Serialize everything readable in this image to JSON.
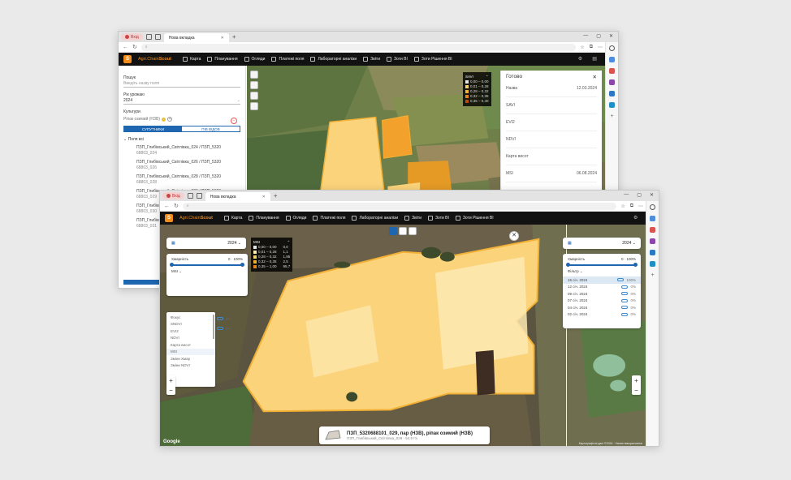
{
  "browser": {
    "profile_label": "Вхід",
    "tab_title": "Нова вкладка",
    "new_tab": "+",
    "window_controls": [
      "—",
      "▢",
      "✕"
    ]
  },
  "app": {
    "brand_prefix": "Agri.Chain",
    "brand_suffix": "Scout",
    "nav": [
      "Карта",
      "Планування",
      "Огляди",
      "Платежі поля",
      "Лабораторні аналізи",
      "Звіти",
      "Зоти ВІ",
      "Зоти Рішення ВІ"
    ]
  },
  "back": {
    "search_label": "Пошук",
    "search_placeholder": "Введіть назву поля",
    "year_label": "Рік урожаю",
    "year_value": "2024",
    "crops_label": "Культури",
    "crop_chip": "Ріпак озимий (НЗВ)",
    "toggle_left": "СУПУТНИКИ",
    "toggle_right": "ПІВ ВІДОВ",
    "tree_head": "Поля всі",
    "tree_items": [
      {
        "name": "ПЗП_Глибівський_Світлівка_024 / ПЗП_5320",
        "sub": "68803_024"
      },
      {
        "name": "ПЗП_Глибівський_Світлівка_026 / ПЗП_5320",
        "sub": "68803_026"
      },
      {
        "name": "ПЗП_Глибівський_Світлівка_028 / ПЗП_5320",
        "sub": "68803_028"
      },
      {
        "name": "ПЗП_Глибівський_Світлівка_029 / ПЗП_5320",
        "sub": "68803_029"
      },
      {
        "name": "ПЗП_Глибівський_Світлівка_030 / ПЗП_5320",
        "sub": "68803_030"
      },
      {
        "name": "ПЗП_Глибівський_Світлівка_031 / ПЗП_5320",
        "sub": "68803_031"
      }
    ],
    "legend": {
      "index": "SAVI",
      "rows": [
        {
          "color": "#e6e6e6",
          "range": "0,00 – 0,00"
        },
        {
          "color": "#f6d36b",
          "range": "0,01 – 0,28"
        },
        {
          "color": "#f2b035",
          "range": "0,28 – 0,32"
        },
        {
          "color": "#e5841c",
          "range": "0,32 – 0,35"
        },
        {
          "color": "#b54c10",
          "range": "0,35 – 0,40"
        }
      ]
    },
    "panel": {
      "title": "Готово",
      "rows": [
        {
          "label": "Назва",
          "value": "12.03.2024"
        },
        {
          "label": "SAVI",
          "value": ""
        },
        {
          "label": "EVI2",
          "value": ""
        },
        {
          "label": "NDVI",
          "value": ""
        },
        {
          "label": "Карта висот",
          "value": ""
        },
        {
          "label": "MSI",
          "value": "06.08.2024"
        }
      ]
    }
  },
  "front": {
    "left_date_year": "2024",
    "right_date_year": "2024",
    "cloud_label": "Хмарність",
    "cloud_value": "0 · 100%",
    "index_select": "MSI",
    "right_select": "Фільтр",
    "legend": {
      "index": "MSI",
      "rows": [
        {
          "color": "#e6e6e6",
          "range": "0,00 – 0,00",
          "area": "0,0"
        },
        {
          "color": "#fdeeb0",
          "range": "0,01 – 0,28",
          "area": "1,1"
        },
        {
          "color": "#f6d36b",
          "range": "0,28 – 0,32",
          "area": "1,95"
        },
        {
          "color": "#f2b035",
          "range": "0,32 – 0,35",
          "area": "2,5"
        },
        {
          "color": "#e5841c",
          "range": "0,35 – 1,00",
          "area": "95,7"
        }
      ]
    },
    "index_options": [
      "Фокус",
      "SNDVI",
      "EVI2",
      "NDVI",
      "Карта висот",
      "MSI",
      "Зміни Хмар",
      "Зміни NDVI"
    ],
    "index_selected": "MSI",
    "mini_dates": [
      "0%",
      "0%",
      "",
      "",
      ""
    ],
    "right_dates": [
      {
        "date": "16 січ. 2024",
        "pct": "100%",
        "selected": true
      },
      {
        "date": "12 січ. 2024",
        "pct": "0%",
        "selected": false
      },
      {
        "date": "09 січ. 2024",
        "pct": "0%",
        "selected": false
      },
      {
        "date": "07 січ. 2024",
        "pct": "0%",
        "selected": false
      },
      {
        "date": "04 січ. 2024",
        "pct": "0%",
        "selected": false
      },
      {
        "date": "02 січ. 2024",
        "pct": "0%",
        "selected": false
      }
    ],
    "info_title": "ПЗП_5320688101_029, пар (НЗВ), ріпак озимий (НЗВ)",
    "info_sub": "ПЗП_Глибівський_Світлівка_029 · 54,9 Га",
    "google": "Google",
    "attribution": "Картографічні дані ©2024 · Умови використання"
  },
  "colors": {
    "accent": "#1f66b0",
    "brand": "#f28c1a",
    "field_fill": "#fbd37a"
  }
}
